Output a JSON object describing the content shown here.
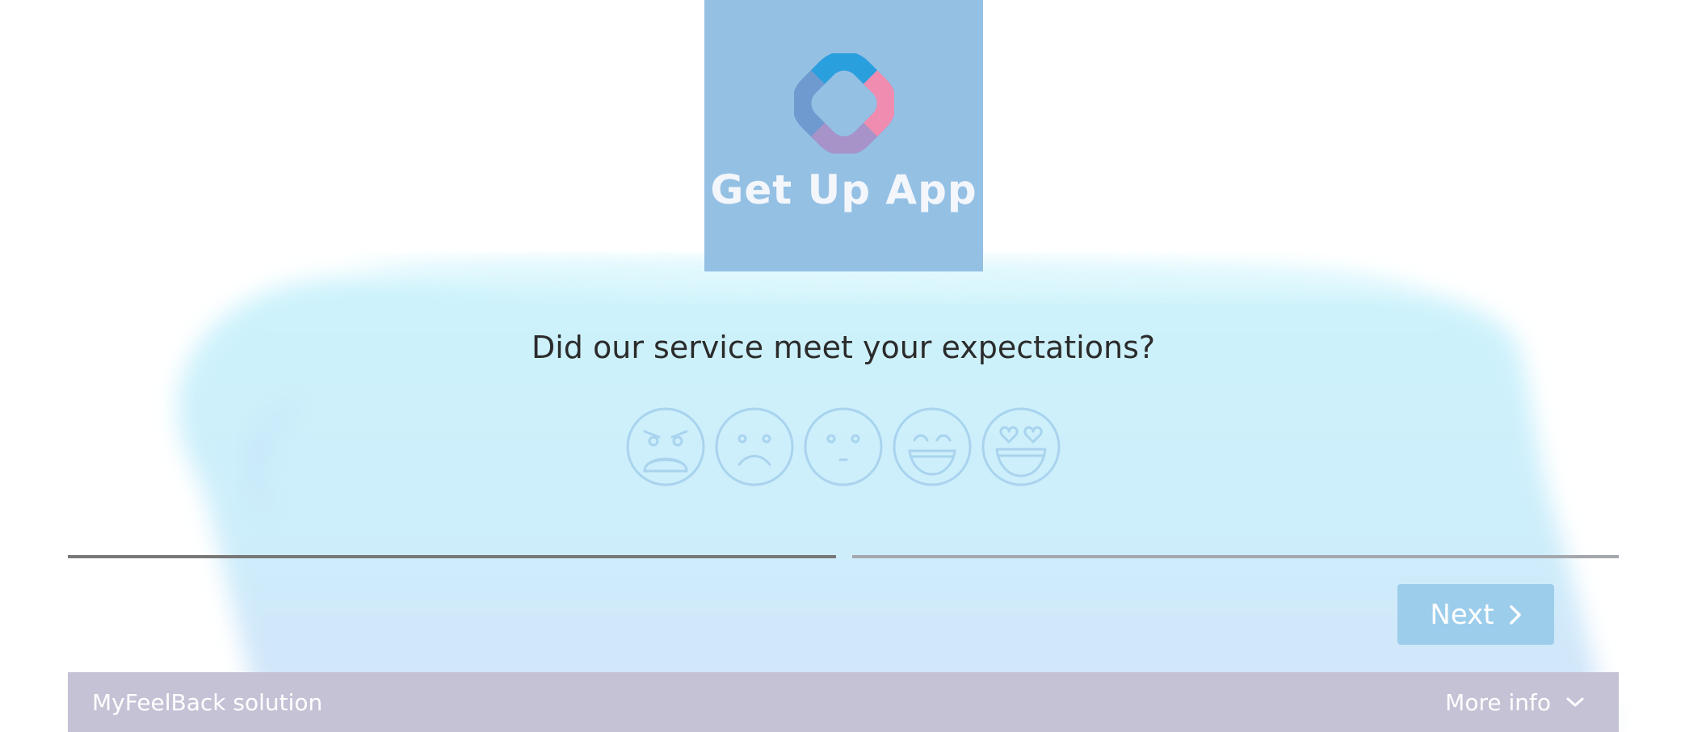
{
  "logo": {
    "text": "Get Up App",
    "background_color": "#94c0e4"
  },
  "survey": {
    "question": "Did our service meet your expectations?",
    "ratings": [
      {
        "icon": "angry-face-icon"
      },
      {
        "icon": "sad-face-icon"
      },
      {
        "icon": "neutral-face-icon"
      },
      {
        "icon": "happy-face-icon"
      },
      {
        "icon": "heart-eyes-face-icon"
      }
    ],
    "icon_color": "#a9d3ee",
    "progress": {
      "completed_color": "#787878",
      "remaining_color": "#a4a8ae"
    }
  },
  "navigation": {
    "next_label": "Next",
    "next_icon": "chevron-right-icon",
    "button_color": "#9ccdeb"
  },
  "footer": {
    "brand_label": "MyFeelBack solution",
    "more_info_label": "More info",
    "more_info_icon": "chevron-down-icon",
    "background_color": "#c5c2d6"
  }
}
